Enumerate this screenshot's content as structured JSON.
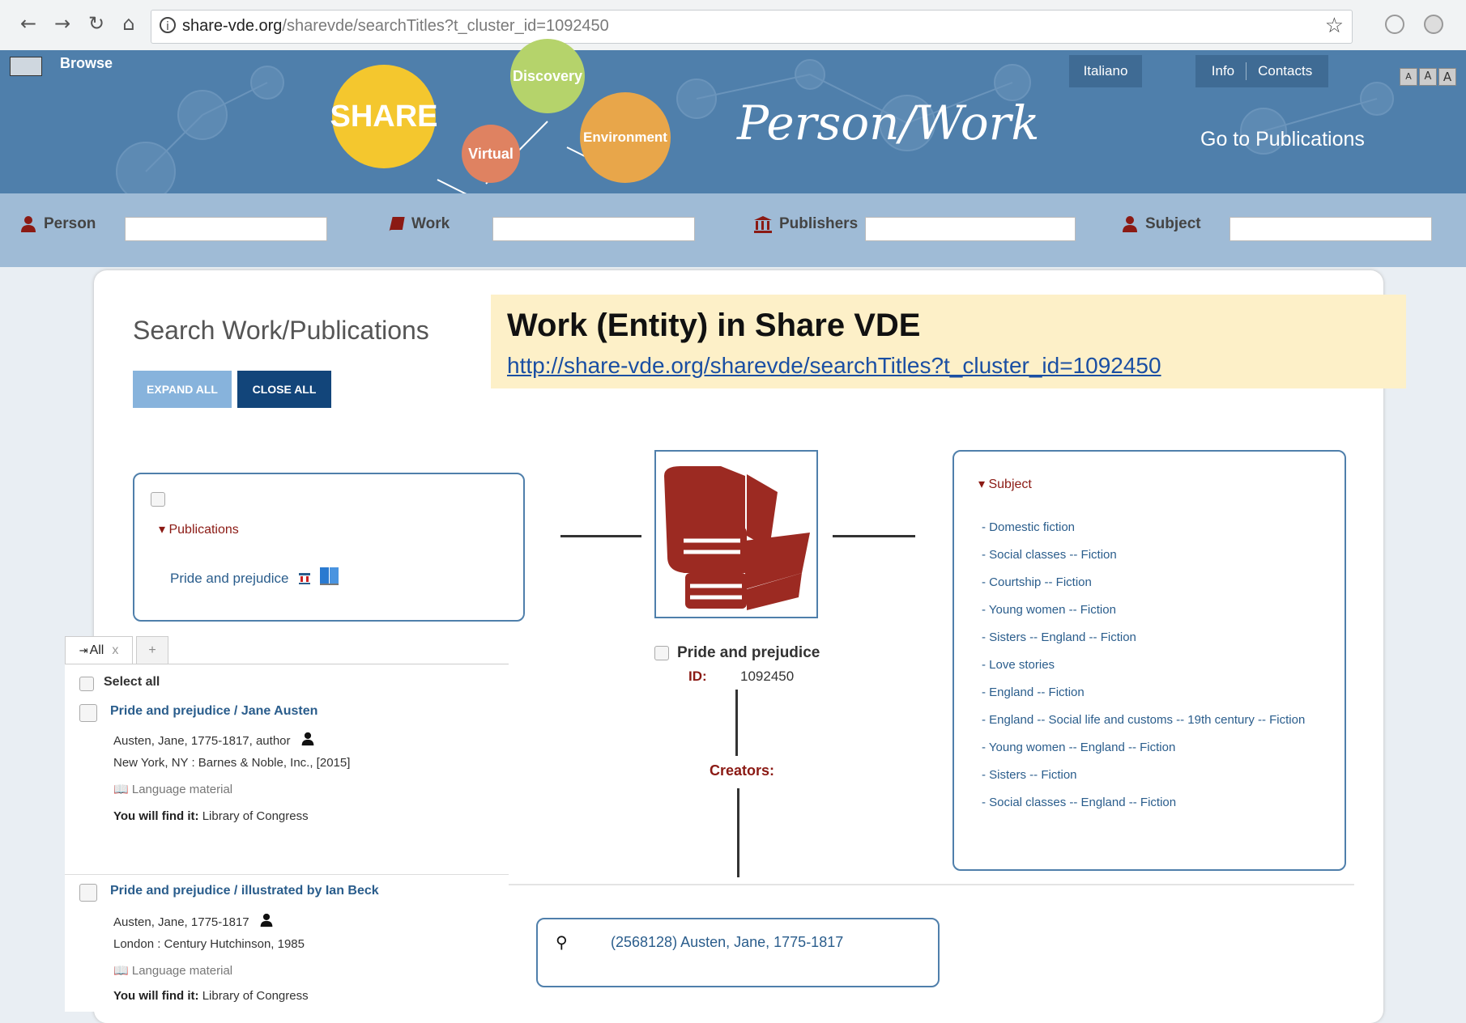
{
  "browser": {
    "url_host": "share-vde.org",
    "url_path": "/sharevde/searchTitles?t_cluster_id=1092450"
  },
  "header": {
    "browse_label": "Browse",
    "bubbles": {
      "share": "SHARE",
      "discovery": "Discovery",
      "virtual": "Virtual",
      "environment": "Environment"
    },
    "title": "Person/Work",
    "language_button": "Italiano",
    "info_label": "Info",
    "contacts_label": "Contacts",
    "goto_publications": "Go to Publications",
    "font_size_buttons": [
      "A",
      "A",
      "A"
    ]
  },
  "search_fields": [
    {
      "label": "Person",
      "icon": "person-icon"
    },
    {
      "label": "Work",
      "icon": "book-icon"
    },
    {
      "label": "Publishers",
      "icon": "building-icon"
    },
    {
      "label": "Subject",
      "icon": "person-icon"
    }
  ],
  "main": {
    "search_title": "Search Work/Publications",
    "expand_all": "EXPAND ALL",
    "close_all": "CLOSE ALL"
  },
  "callout": {
    "title": "Work (Entity) in Share VDE",
    "link": "http://share-vde.org/sharevde/searchTitles?t_cluster_id=1092450"
  },
  "publications": {
    "heading": "Publications",
    "item": "Pride and prejudice"
  },
  "work": {
    "title": "Pride and prejudice",
    "id_label": "ID:",
    "id_value": "1092450",
    "creators_label": "Creators:",
    "creator": "(2568128) Austen, Jane, 1775-1817"
  },
  "subject": {
    "heading": "Subject",
    "items": [
      "- Domestic fiction",
      "- Social classes -- Fiction",
      "- Courtship -- Fiction",
      "- Young women -- Fiction",
      "- Sisters -- England -- Fiction",
      "- Love stories",
      "- England -- Fiction",
      "- England -- Social life and customs -- 19th century -- Fiction",
      "- Young women -- England -- Fiction",
      "- Sisters -- Fiction",
      "- Social classes -- England -- Fiction"
    ]
  },
  "results": {
    "tab_all": "All",
    "tab_close": "x",
    "tab_add": "+",
    "select_all": "Select all",
    "found_label": "You will find it:",
    "items": [
      {
        "title": "Pride and prejudice / Jane Austen",
        "author": "Austen, Jane, 1775-1817, author",
        "publisher": "New York, NY : Barnes & Noble, Inc., [2015]",
        "type": "Language material",
        "location": "Library of Congress"
      },
      {
        "title": "Pride and prejudice / illustrated by Ian Beck",
        "author": "Austen, Jane, 1775-1817",
        "publisher": "London : Century Hutchinson, 1985",
        "type": "Language material",
        "location": "Library of Congress"
      }
    ]
  },
  "colors": {
    "banner": "#4f7fab",
    "accent_red": "#8b1a14",
    "link_blue": "#2a5d8c",
    "callout_bg": "#fdf0c8"
  }
}
